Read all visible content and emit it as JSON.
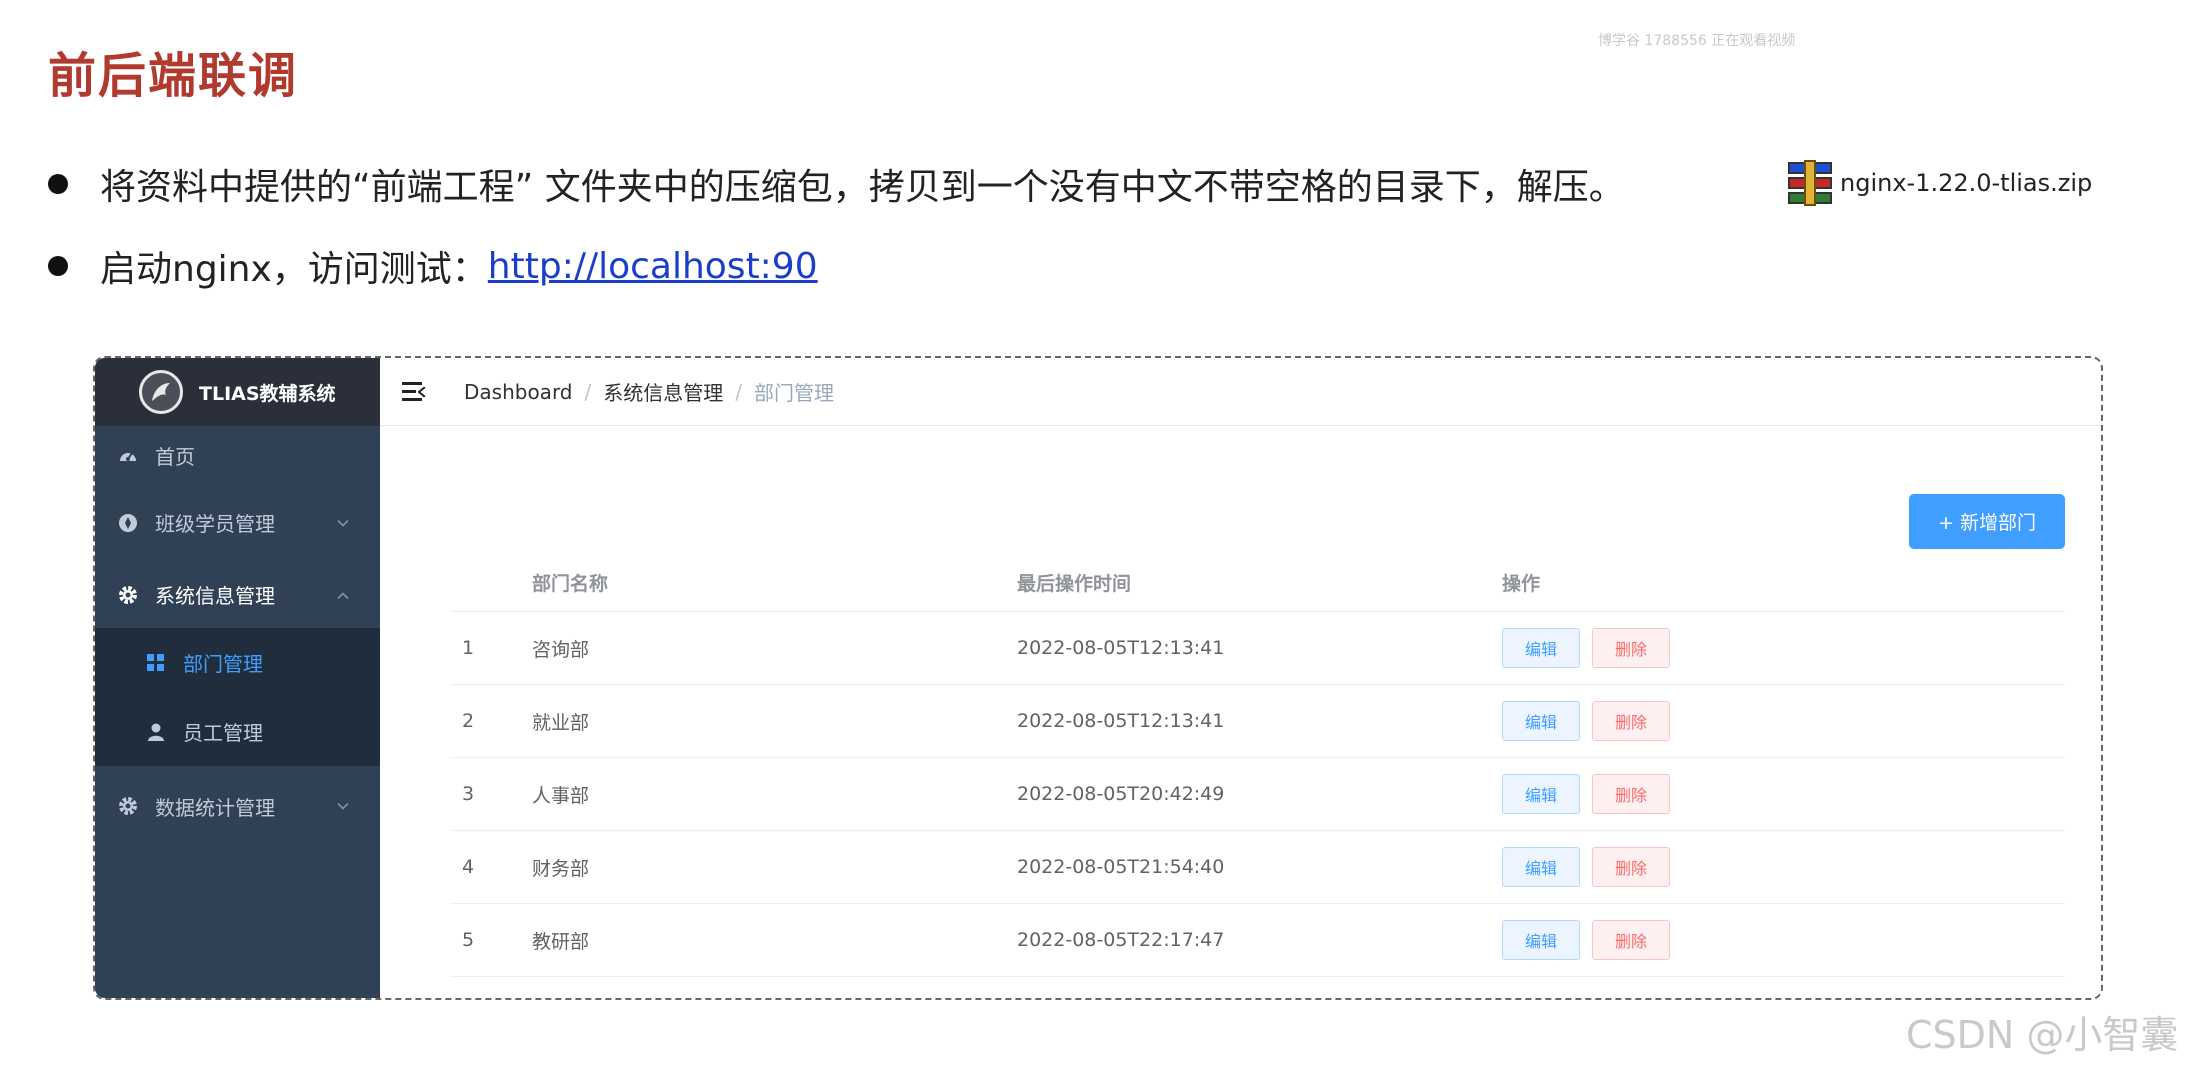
{
  "slide": {
    "title": "前后端联调",
    "watermark_top": "博学谷 1788556 正在观看视频",
    "bullet1": "将资料中提供的“前端工程” 文件夹中的压缩包，拷贝到一个没有中文不带空格的目录下，解压。",
    "zip_name": "nginx-1.22.0-tlias.zip",
    "bullet2_prefix": "启动nginx，访问测试：",
    "bullet2_link": "http://localhost:90",
    "csdn_watermark": "CSDN @小智囊"
  },
  "app": {
    "logo_text": "TLIAS教辅系统",
    "menu": {
      "home": "首页",
      "class_mgmt": "班级学员管理",
      "system_mgmt": "系统信息管理",
      "dept_mgmt": "部门管理",
      "emp_mgmt": "员工管理",
      "stats_mgmt": "数据统计管理"
    },
    "breadcrumb": [
      "Dashboard",
      "系统信息管理",
      "部门管理"
    ],
    "add_button": "+ 新增部门",
    "table": {
      "headers": [
        "部门名称",
        "最后操作时间",
        "操作"
      ],
      "rows": [
        {
          "idx": "1",
          "name": "咨询部",
          "time": "2022-08-05T12:13:41"
        },
        {
          "idx": "2",
          "name": "就业部",
          "time": "2022-08-05T12:13:41"
        },
        {
          "idx": "3",
          "name": "人事部",
          "time": "2022-08-05T20:42:49"
        },
        {
          "idx": "4",
          "name": "财务部",
          "time": "2022-08-05T21:54:40"
        },
        {
          "idx": "5",
          "name": "教研部",
          "time": "2022-08-05T22:17:47"
        }
      ],
      "edit_label": "编辑",
      "delete_label": "删除"
    }
  },
  "colors": {
    "title": "#b03a2e",
    "sidebar_bg": "#304156",
    "logo_bg": "#2b2f3a",
    "submenu_bg": "#1f2d3d",
    "accent": "#409eff",
    "danger": "#f56c6c"
  },
  "icons": {
    "home": "dashboard-icon",
    "class": "compass-icon",
    "system": "gear-icon",
    "dept": "grid-icon",
    "emp": "user-icon",
    "stats": "gear-icon",
    "zip": "winrar-archive-icon",
    "menu_toggle": "hamburger-icon"
  }
}
